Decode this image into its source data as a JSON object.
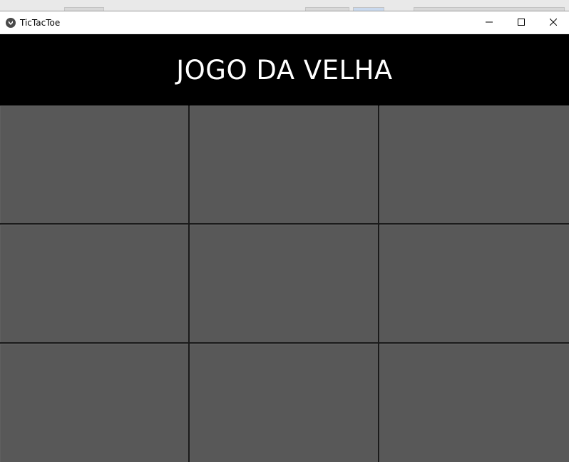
{
  "window": {
    "title": "TicTacToe",
    "icon": "kivy-app-icon",
    "controls": [
      "minimize-icon",
      "maximize-icon",
      "close-icon"
    ]
  },
  "header": {
    "title": "JOGO DA VELHA"
  },
  "board": {
    "cells": [
      "",
      "",
      "",
      "",
      "",
      "",
      "",
      "",
      ""
    ]
  },
  "colors": {
    "header_bg": "#000000",
    "title_text": "#ffffff",
    "cell_bg": "#585858",
    "grid_line": "#1a1a1a"
  }
}
